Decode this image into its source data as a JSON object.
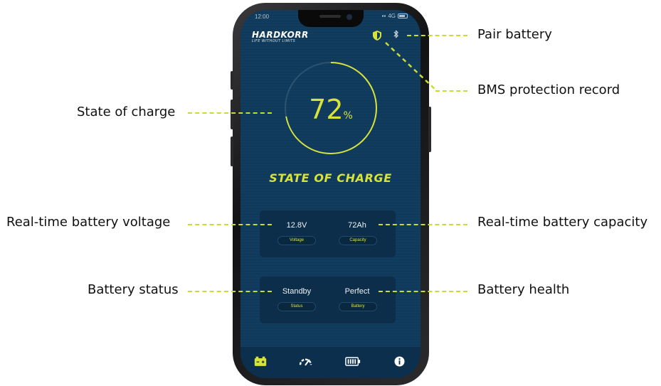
{
  "callouts": {
    "pair_battery": "Pair battery",
    "bms_protection": "BMS protection record",
    "state_of_charge": "State of charge",
    "voltage": "Real-time battery voltage",
    "capacity": "Real-time battery capacity",
    "status": "Battery status",
    "health": "Battery health"
  },
  "status_bar": {
    "time": "12:00",
    "network": "4G"
  },
  "app": {
    "brand": "HARDKORR",
    "tagline": "LIFE WITHOUT LIMITS",
    "header_icons": [
      "shield-icon",
      "bluetooth-icon"
    ],
    "soc": {
      "value": "72",
      "unit": "%",
      "fraction": 0.72,
      "title": "STATE OF CHARGE"
    },
    "card1": {
      "voltage_value": "12.8V",
      "voltage_label": "Voltage",
      "capacity_value": "72Ah",
      "capacity_label": "Capacity"
    },
    "card2": {
      "status_value": "Standby",
      "status_label": "Status",
      "battery_value": "Perfect",
      "battery_label": "Battery"
    },
    "tabs": [
      "battery-charge-icon",
      "gauge-icon",
      "battery-level-icon",
      "info-icon"
    ]
  },
  "colors": {
    "accent": "#d8e33a",
    "screen_bg": "#0f3a5c",
    "card_bg": "#0c2e4a",
    "dash": "#c7dc35"
  }
}
